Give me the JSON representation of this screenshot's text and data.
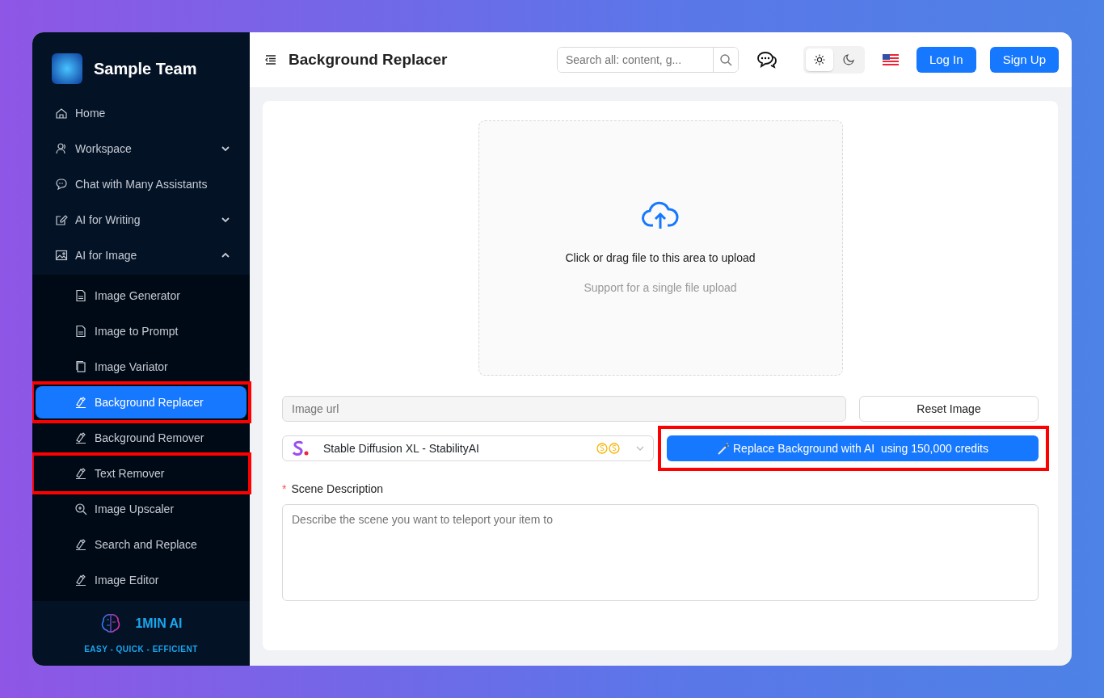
{
  "sidebar": {
    "team_name": "Sample Team",
    "items": [
      {
        "label": "Home",
        "kind": "home"
      },
      {
        "label": "Workspace",
        "kind": "users",
        "expanded": false
      },
      {
        "label": "Chat with Many Assistants",
        "kind": "chat"
      },
      {
        "label": "AI for Writing",
        "kind": "edit",
        "expanded": false
      },
      {
        "label": "AI for Image",
        "kind": "image",
        "expanded": true,
        "children": [
          {
            "label": "Image Generator",
            "kind": "file",
            "selected": false,
            "highlighted": false
          },
          {
            "label": "Image to Prompt",
            "kind": "file",
            "selected": false,
            "highlighted": false
          },
          {
            "label": "Image Variator",
            "kind": "copy",
            "selected": false,
            "highlighted": false
          },
          {
            "label": "Background Replacer",
            "kind": "brush",
            "selected": true,
            "highlighted": true
          },
          {
            "label": "Background Remover",
            "kind": "brush",
            "selected": false,
            "highlighted": false
          },
          {
            "label": "Text Remover",
            "kind": "brush",
            "selected": false,
            "highlighted": true
          },
          {
            "label": "Image Upscaler",
            "kind": "zoom",
            "selected": false,
            "highlighted": false
          },
          {
            "label": "Search and Replace",
            "kind": "brush",
            "selected": false,
            "highlighted": false
          },
          {
            "label": "Image Editor",
            "kind": "brush",
            "selected": false,
            "highlighted": false
          }
        ]
      }
    ],
    "brand": "1MIN AI",
    "tagline": "EASY - QUICK - EFFICIENT"
  },
  "header": {
    "title": "Background Replacer",
    "search": {
      "placeholder": "Search all: content, g..."
    },
    "theme": [
      {
        "kind": "light",
        "selected": true
      },
      {
        "kind": "dark",
        "selected": false
      }
    ],
    "buttons": [
      "Log In",
      "Sign Up"
    ]
  },
  "upload": {
    "text": "Click or drag file to this area to upload",
    "hint": "Support for a single file upload"
  },
  "image_url": {
    "placeholder": "Image url"
  },
  "reset_button": "Reset Image",
  "model": {
    "value": "Stable Diffusion XL - StabilityAI"
  },
  "action_button": {
    "label": "Replace Background with AI  using 150,000 credits",
    "highlighted": true
  },
  "scene": {
    "required_mark": "*",
    "label": "Scene Description",
    "placeholder": "Describe the scene you want to teleport your item to"
  }
}
